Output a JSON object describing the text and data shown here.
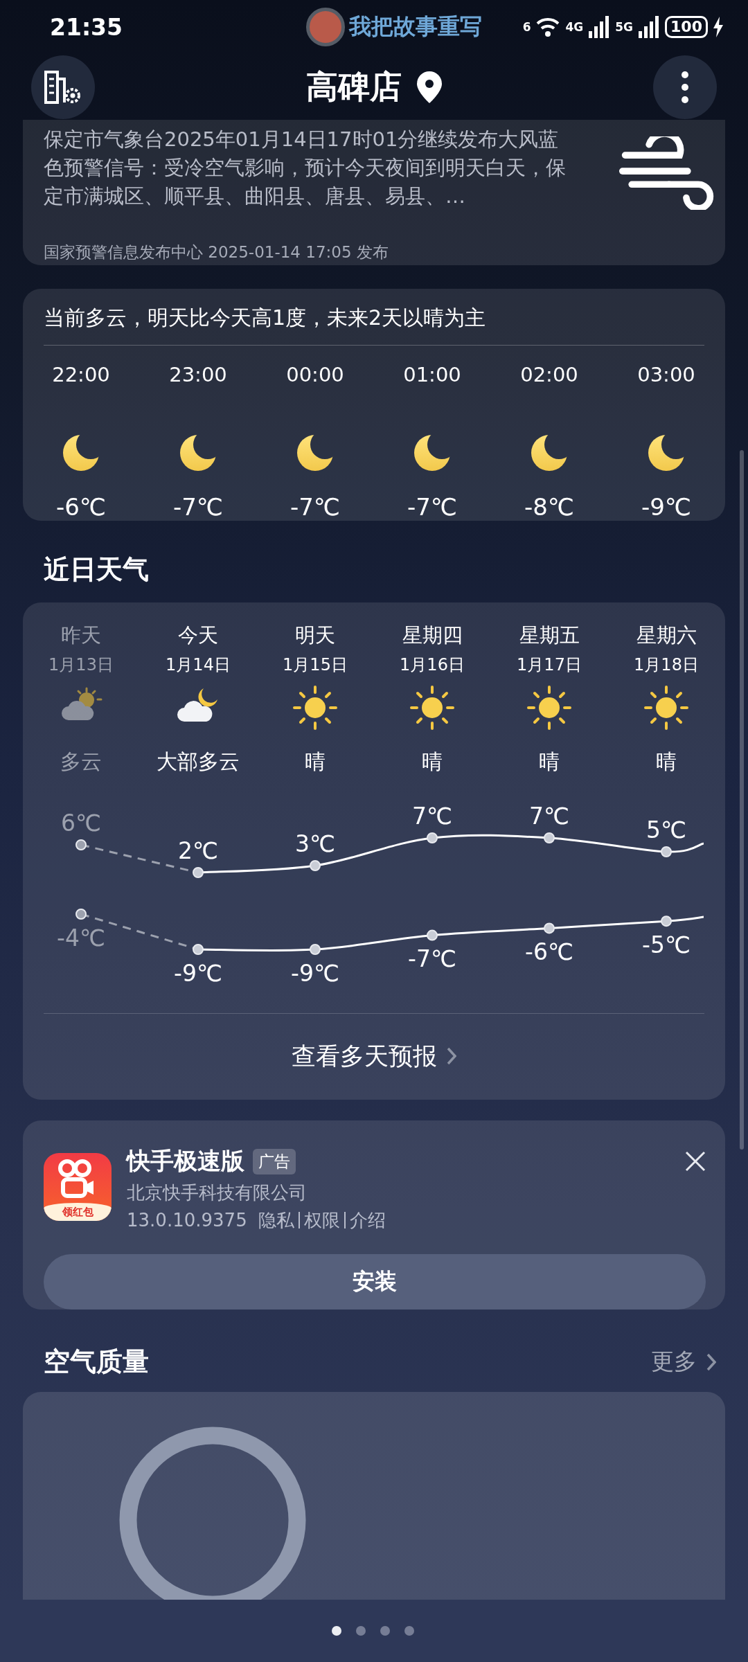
{
  "status_bar": {
    "time": "21:35",
    "ticker": "我把故事重写",
    "wifi_label": "6",
    "networks": [
      "4G",
      "5G"
    ],
    "battery": "100"
  },
  "header": {
    "city": "高碑店"
  },
  "warning": {
    "text": "保定市气象台2025年01月14日17时01分继续发布大风蓝色预警信号：受冷空气影响，预计今天夜间到明天白天，保定市满城区、顺平县、曲阳县、唐县、易县、…",
    "source": "国家预警信息发布中心 2025-01-14 17:05 发布"
  },
  "hourly": {
    "summary": "当前多云，明天比今天高1度，未来2天以晴为主",
    "hours": [
      {
        "time": "22:00",
        "temp": "-6℃"
      },
      {
        "time": "23:00",
        "temp": "-7℃"
      },
      {
        "time": "00:00",
        "temp": "-7℃"
      },
      {
        "time": "01:00",
        "temp": "-7℃"
      },
      {
        "time": "02:00",
        "temp": "-8℃"
      },
      {
        "time": "03:00",
        "temp": "-9℃"
      }
    ]
  },
  "daily": {
    "title": "近日天气",
    "days": [
      {
        "label": "昨天",
        "date": "1月13日",
        "condition": "多云",
        "kind": "cloudy-day",
        "past": true,
        "high": "6℃",
        "low": "-4℃"
      },
      {
        "label": "今天",
        "date": "1月14日",
        "condition": "大部多云",
        "kind": "cloudy-night",
        "past": false,
        "high": "2℃",
        "low": "-9℃"
      },
      {
        "label": "明天",
        "date": "1月15日",
        "condition": "晴",
        "kind": "sunny",
        "past": false,
        "high": "3℃",
        "low": "-9℃"
      },
      {
        "label": "星期四",
        "date": "1月16日",
        "condition": "晴",
        "kind": "sunny",
        "past": false,
        "high": "7℃",
        "low": "-7℃"
      },
      {
        "label": "星期五",
        "date": "1月17日",
        "condition": "晴",
        "kind": "sunny",
        "past": false,
        "high": "7℃",
        "low": "-6℃"
      },
      {
        "label": "星期六",
        "date": "1月18日",
        "condition": "晴",
        "kind": "sunny",
        "past": false,
        "high": "5℃",
        "low": "-5℃"
      }
    ],
    "more": "查看多天预报"
  },
  "ad": {
    "name": "快手极速版",
    "badge": "广告",
    "icon_caption": "领红包",
    "company": "北京快手科技有限公司",
    "version": "13.0.10.9375",
    "links": [
      "隐私",
      "权限",
      "介绍"
    ],
    "install": "安装"
  },
  "air": {
    "title": "空气质量",
    "more": "更多"
  },
  "pager": [
    {
      "selected": true
    },
    {
      "selected": false
    },
    {
      "selected": false
    },
    {
      "selected": false
    }
  ]
}
